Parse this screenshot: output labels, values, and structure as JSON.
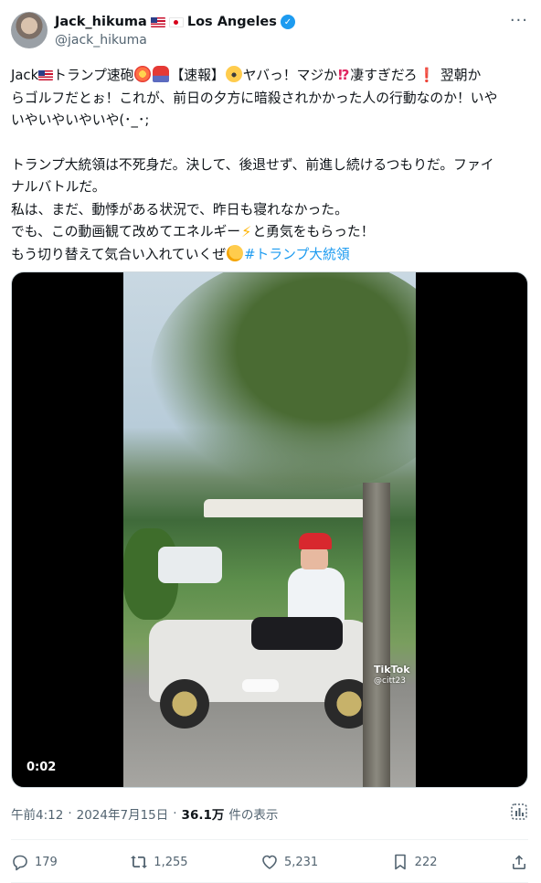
{
  "tweet": {
    "author": {
      "display_name": "Jack_hikuma",
      "location": "Los Angeles",
      "handle": "@jack_hikuma",
      "verified": true,
      "flags": [
        "us-flag",
        "jp-flag"
      ]
    },
    "more_menu": "···",
    "text": {
      "line1_a": "Jack",
      "line1_b": "トランプ速砲",
      "line1_c": "【速報】",
      "line1_d": "ヤバっ！マジか",
      "line1_e": "凄すぎだろ",
      "line1_f": " 翌朝か",
      "line2": "らゴルフだとぉ！これが、前日の夕方に暗殺されかかった人の行動なのか！いや",
      "line3": "いやいやいやいや(･_･;",
      "para2_line1": "トランプ大統領は不死身だ。決して、後退せず、前進し続けるつもりだ。ファイ",
      "para2_line2": "ナルバトルだ。",
      "para2_line3": "私は、まだ、動悸がある状況で、昨日も寝れなかった。",
      "para2_line4_a": "でも、この動画観て改めてエネルギー",
      "para2_line4_b": "と勇気をもらった！",
      "para2_line5_a": "もう切り替えて気合い入れていくぜ",
      "hashtag": "#トランプ大統領"
    },
    "media": {
      "type": "video",
      "timecode": "0:02",
      "watermark": "TikTok",
      "watermark_user": "@citt23"
    },
    "meta": {
      "time": "午前4:12",
      "sep1": "·",
      "date": "2024年7月15日",
      "sep2": "·",
      "views": "36.1万",
      "views_label": "件の表示"
    },
    "actions": {
      "replies": "179",
      "reposts": "1,255",
      "likes": "5,231",
      "bookmarks": "222"
    }
  },
  "colors": {
    "accent": "#1d9bf0",
    "text": "#0f1419",
    "secondary": "#536471"
  }
}
